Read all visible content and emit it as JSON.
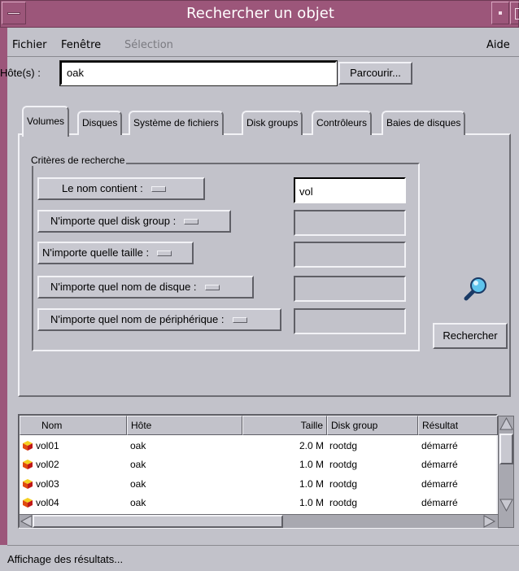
{
  "window": {
    "title": "Rechercher un objet",
    "title_bar_color": "#9c567a"
  },
  "menubar": {
    "items": [
      {
        "label": "Fichier",
        "enabled": true
      },
      {
        "label": "Fenêtre",
        "enabled": true
      },
      {
        "label": "Sélection",
        "enabled": false
      }
    ],
    "help": "Aide"
  },
  "host": {
    "label": "Hôte(s) :",
    "value": "oak",
    "browse_label": "Parcourir..."
  },
  "tabs": [
    {
      "label": "Volumes",
      "active": true
    },
    {
      "label": "Disques",
      "active": false
    },
    {
      "label": "Système de fichiers",
      "active": false
    },
    {
      "label": "Disk groups",
      "active": false
    },
    {
      "label": "Contrôleurs",
      "active": false
    },
    {
      "label": "Baies de disques",
      "active": false
    }
  ],
  "criteria": {
    "legend": "Critères de recherche",
    "rows": [
      {
        "label": "Le nom contient :",
        "value": "vol"
      },
      {
        "label": "N'importe quel disk group :",
        "value": ""
      },
      {
        "label": "N'importe quelle taille :",
        "value": ""
      },
      {
        "label": "N'importe quel nom de disque :",
        "value": ""
      },
      {
        "label": "N'importe quel nom de périphérique :",
        "value": ""
      }
    ],
    "search_label": "Rechercher",
    "search_icon": "magnifier-icon"
  },
  "results": {
    "columns": [
      "Nom",
      "Hôte",
      "Taille",
      "Disk group",
      "Résultat"
    ],
    "rows": [
      {
        "name": "vol01",
        "host": "oak",
        "size": "2.0 M",
        "group": "rootdg",
        "result": "démarré"
      },
      {
        "name": "vol02",
        "host": "oak",
        "size": "1.0 M",
        "group": "rootdg",
        "result": "démarré"
      },
      {
        "name": "vol03",
        "host": "oak",
        "size": "1.0 M",
        "group": "rootdg",
        "result": "démarré"
      },
      {
        "name": "vol04",
        "host": "oak",
        "size": "1.0 M",
        "group": "rootdg",
        "result": "démarré"
      }
    ],
    "row_icon": "volume-cube-icon"
  },
  "status": {
    "text": "Affichage des résultats..."
  }
}
